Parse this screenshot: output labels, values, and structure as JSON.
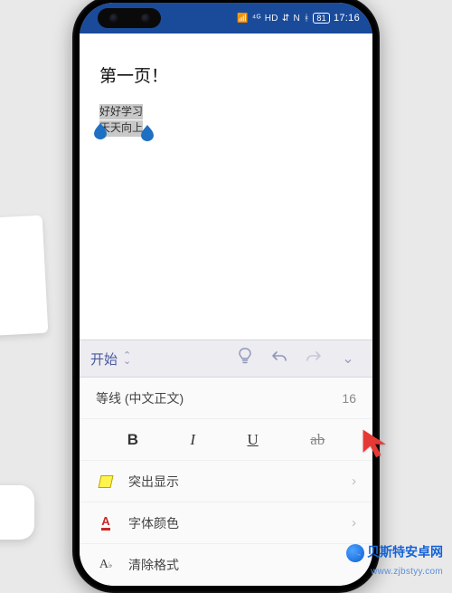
{
  "status": {
    "signal": "⁴ᴳ",
    "wifi_icon": "wifi",
    "volte": "HD",
    "nfc": "N",
    "bt": "bt",
    "battery_pct": "81",
    "time": "17:16"
  },
  "doc": {
    "heading": "第一页！",
    "selected_line1": "好好学习",
    "selected_line2": "天天向上"
  },
  "ribbon": {
    "tab_label": "开始",
    "tips_icon": "lightbulb",
    "undo_icon": "undo",
    "redo_icon": "redo"
  },
  "panel": {
    "font_name": "等线 (中文正文)",
    "font_size": "16",
    "bold": "B",
    "italic": "I",
    "underline": "U",
    "strike": "ab",
    "highlight_label": "突出显示",
    "font_color_label": "字体颜色",
    "font_color_letter": "A",
    "clear_format_label": "清除格式",
    "clear_format_icon": "A♭"
  },
  "watermark": {
    "cn": "贝斯特安卓网",
    "en": "www.zjbstyy.com"
  }
}
